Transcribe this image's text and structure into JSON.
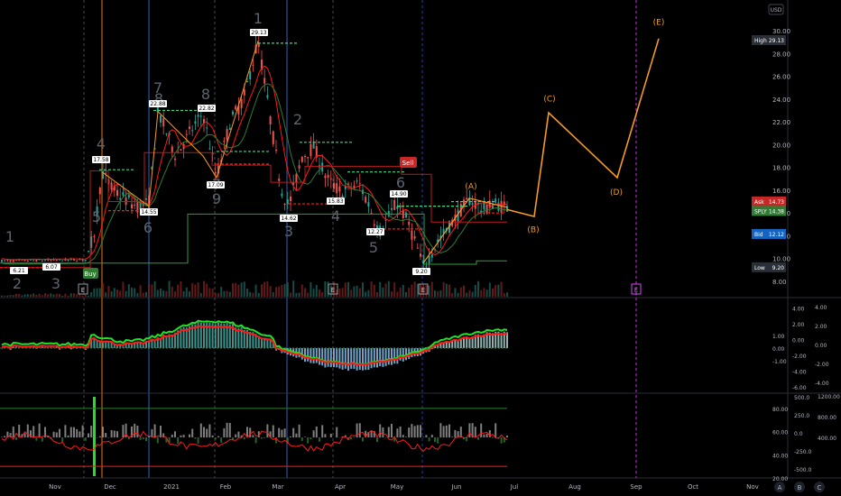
{
  "colors": {
    "bg": "#000000",
    "up": "#26a69a",
    "down": "#ef5350",
    "bright_green": "#22e026",
    "bright_red": "#ff1a1a",
    "orange": "#f59a23",
    "magenta": "#e040fb",
    "dash_green": "#3ddc84",
    "blue_line": "#1e3a6e",
    "brown_line": "#8b4513",
    "axis_text": "#b2b5be",
    "badge_dark": "#2a2e39",
    "badge_red": "#c62828",
    "badge_green": "#2e7d32",
    "badge_blue": "#1565c0"
  },
  "currency": "USD",
  "price_badges": {
    "high": {
      "label": "High",
      "value": "29.13"
    },
    "ask": {
      "label": "Ask",
      "value": "14.73"
    },
    "last": {
      "label": "SPLY",
      "value": "14.38"
    },
    "bid": {
      "label": "Bid",
      "value": "12.12"
    },
    "low": {
      "label": "Low",
      "value": "9.20"
    }
  },
  "time_axis": {
    "labels": [
      "Nov",
      "Dec",
      "2021",
      "Feb",
      "Mar",
      "Apr",
      "May",
      "Jun",
      "Jul",
      "Aug",
      "Sep",
      "Oct",
      "Nov"
    ]
  },
  "corner_buttons": [
    "A",
    "B",
    "C"
  ],
  "signals": {
    "buy": "Buy",
    "sell": "Sell"
  },
  "event_markers": [
    "E",
    "E",
    "E",
    "E"
  ],
  "wave_labels": {
    "main": [
      "1",
      "2",
      "3",
      "4",
      "5",
      "6",
      "7",
      "8",
      "9",
      "1",
      "2",
      "3",
      "4",
      "5",
      "6",
      "7",
      "8",
      "9",
      "1",
      "2",
      "3",
      "4",
      "5",
      "6",
      "7",
      "8",
      "9",
      "1",
      "3"
    ],
    "projection": [
      "(A)",
      "(B)",
      "(C)",
      "(D)",
      "(E)"
    ]
  },
  "chart_data": {
    "type": "line",
    "price_panel": {
      "ylim": [
        8,
        30
      ],
      "y_ticks": [
        "8.00",
        "10.00",
        "12.00",
        "14.00",
        "16.00",
        "18.00",
        "20.00",
        "22.00",
        "24.00",
        "26.00",
        "28.00",
        "30.00"
      ],
      "x": [
        "Nov",
        "Dec",
        "2021",
        "Feb",
        "Mar",
        "Apr",
        "May",
        "Jun",
        "Jul",
        "Aug",
        "Sep",
        "Oct",
        "Nov"
      ],
      "price_labels": [
        "6.21",
        "6.07",
        "17.58",
        "14.55",
        "22.88",
        "22.82",
        "17.09",
        "29.13",
        "14.62",
        "15.83",
        "14.90",
        "12.27",
        "9.20"
      ],
      "projection_path": [
        {
          "label": "(A)",
          "value": 15.3
        },
        {
          "label": "(B)",
          "value": 13.7
        },
        {
          "label": "(C)",
          "value": 22.8
        },
        {
          "label": "(D)",
          "value": 17.1
        },
        {
          "label": "(E)",
          "value": 29.3
        }
      ]
    },
    "macd_panel": {
      "left_ticks": [
        "-1.00",
        "0.00",
        "1.00"
      ],
      "right_ticks": [
        "-6.00",
        "-4.00",
        "-2.00",
        "0.00",
        "2.00",
        "4.00"
      ],
      "far_right_ticks": [
        "-4.00",
        "-2.00",
        "0.00",
        "2.00",
        "4.00"
      ]
    },
    "oscillator_panel": {
      "left_ticks": [
        "20.00",
        "40.00",
        "60.00",
        "80.00"
      ],
      "mid_ticks": [
        "-500.0",
        "-250.0",
        "0.0",
        "250.0",
        "500.0"
      ],
      "right_ticks": [
        "400.00",
        "800.00",
        "1200.00"
      ]
    }
  }
}
